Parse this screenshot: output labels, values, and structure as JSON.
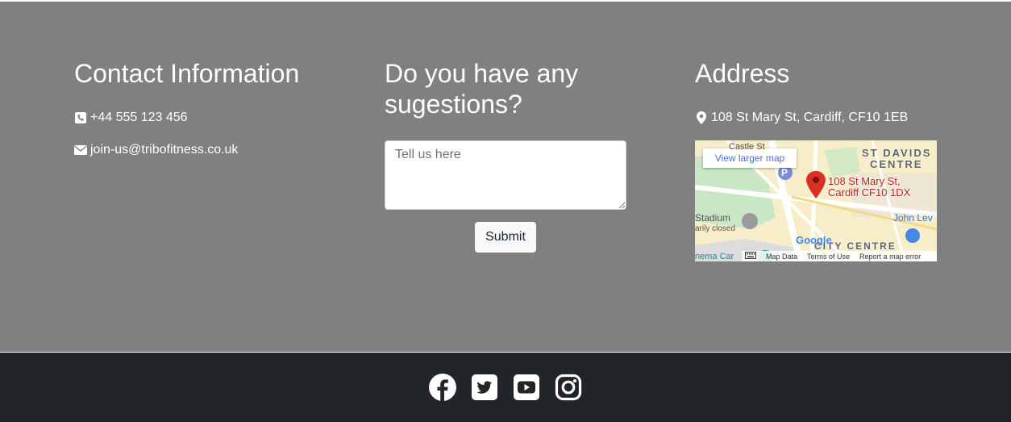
{
  "contact": {
    "heading": "Contact Information",
    "phone": "+44 555 123 456",
    "email": "join-us@tribofitness.co.uk",
    "phone_icon": "phone-square-icon",
    "email_icon": "envelope-icon"
  },
  "suggestions": {
    "heading_line1": "Do you have any",
    "heading_line2": "sugestions?",
    "placeholder": "Tell us here",
    "submit_label": "Submit"
  },
  "address": {
    "heading": "Address",
    "text": "108 St Mary St, Cardiff, CF10 1EB",
    "icon": "map-marker-icon",
    "map": {
      "larger_map_label": "View larger map",
      "pin_label_line1": "108 St Mary St,",
      "pin_label_line2": "Cardiff CF10 1DX",
      "district_line1": "ST DAVIDS",
      "district_line2": "CENTRE",
      "street_label": "Castle St",
      "stadium_line1": "Stadium",
      "stadium_line2": "arily closed",
      "store_label": "John Lev",
      "city_centre": "CITY CENTRE",
      "cinema": "nema Car",
      "google_logo": "Google",
      "map_data": "Map Data",
      "terms": "Terms of Use",
      "report": "Report a map error",
      "parking": "P"
    }
  },
  "social": {
    "icons": [
      "facebook-icon",
      "twitter-icon",
      "youtube-icon",
      "instagram-icon"
    ]
  },
  "colors": {
    "section_bg": "#808080",
    "footer_bg": "#212529",
    "text": "#ffffff",
    "button_bg": "#f8f9fa"
  }
}
